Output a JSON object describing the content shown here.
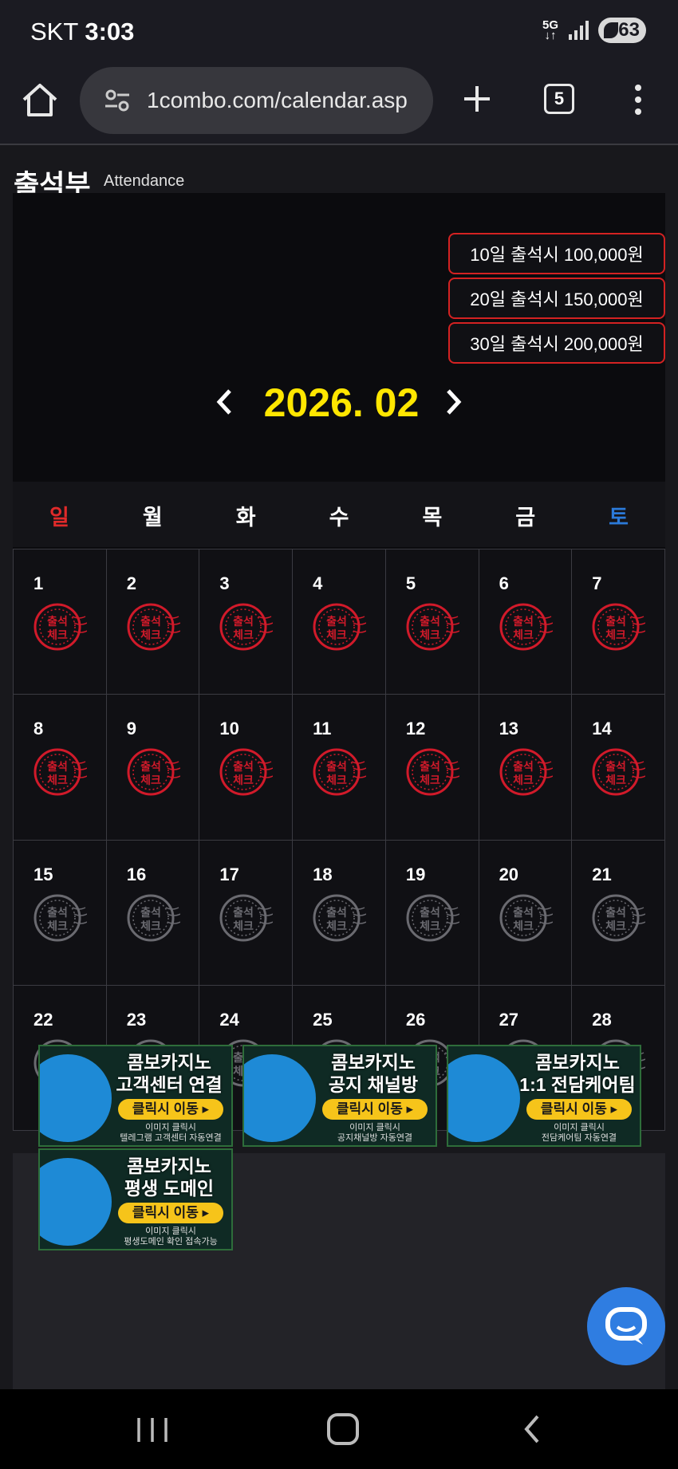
{
  "status_bar": {
    "carrier": "SKT",
    "time": "3:03",
    "network": "5G",
    "battery": "63"
  },
  "browser": {
    "url": "1combo.com/calendar.asp",
    "tab_count": "5"
  },
  "page": {
    "title": "출석부",
    "subtitle": "Attendance",
    "rewards": [
      "10일 출석시 100,000원",
      "20일 출석시 150,000원",
      "30일 출석시 200,000원"
    ],
    "month_label": "2026. 02",
    "weekdays": [
      "일",
      "월",
      "화",
      "수",
      "목",
      "금",
      "토"
    ],
    "stamp_text": "출석체크",
    "days": [
      {
        "day": "1",
        "checked": true
      },
      {
        "day": "2",
        "checked": true
      },
      {
        "day": "3",
        "checked": true
      },
      {
        "day": "4",
        "checked": true
      },
      {
        "day": "5",
        "checked": true
      },
      {
        "day": "6",
        "checked": true
      },
      {
        "day": "7",
        "checked": true
      },
      {
        "day": "8",
        "checked": true
      },
      {
        "day": "9",
        "checked": true
      },
      {
        "day": "10",
        "checked": true
      },
      {
        "day": "11",
        "checked": true
      },
      {
        "day": "12",
        "checked": true
      },
      {
        "day": "13",
        "checked": true
      },
      {
        "day": "14",
        "checked": true
      },
      {
        "day": "15",
        "checked": false
      },
      {
        "day": "16",
        "checked": false
      },
      {
        "day": "17",
        "checked": false
      },
      {
        "day": "18",
        "checked": false
      },
      {
        "day": "19",
        "checked": false
      },
      {
        "day": "20",
        "checked": false
      },
      {
        "day": "21",
        "checked": false
      },
      {
        "day": "22",
        "checked": false
      },
      {
        "day": "23",
        "checked": false
      },
      {
        "day": "24",
        "checked": false
      },
      {
        "day": "25",
        "checked": false
      },
      {
        "day": "26",
        "checked": false
      },
      {
        "day": "27",
        "checked": false
      },
      {
        "day": "28",
        "checked": false
      }
    ]
  },
  "banners": [
    {
      "title1": "콤보카지노",
      "title2": "고객센터 연결",
      "click": "클릭시 이동 ▸",
      "note1": "이미지 클릭시",
      "note2": "텔레그램 고객센터 자동연결"
    },
    {
      "title1": "콤보카지노",
      "title2": "공지 채널방",
      "click": "클릭시 이동 ▸",
      "note1": "이미지 클릭시",
      "note2": "공지채널방 자동연결"
    },
    {
      "title1": "콤보카지노",
      "title2": "1:1 전담케어팀",
      "click": "클릭시 이동 ▸",
      "note1": "이미지 클릭시",
      "note2": "전담케어팀 자동연결"
    },
    {
      "title1": "콤보카지노",
      "title2": "평생 도메인",
      "click": "클릭시 이동 ▸",
      "note1": "이미지 클릭시",
      "note2": "평생도메인 확인 접속가능"
    }
  ],
  "colors": {
    "checked_stamp": "#d11a2a",
    "unchecked_stamp": "#6a6a70",
    "month_label": "#ffe600",
    "sunday": "#e02a2a",
    "saturday": "#2b7ad9"
  }
}
